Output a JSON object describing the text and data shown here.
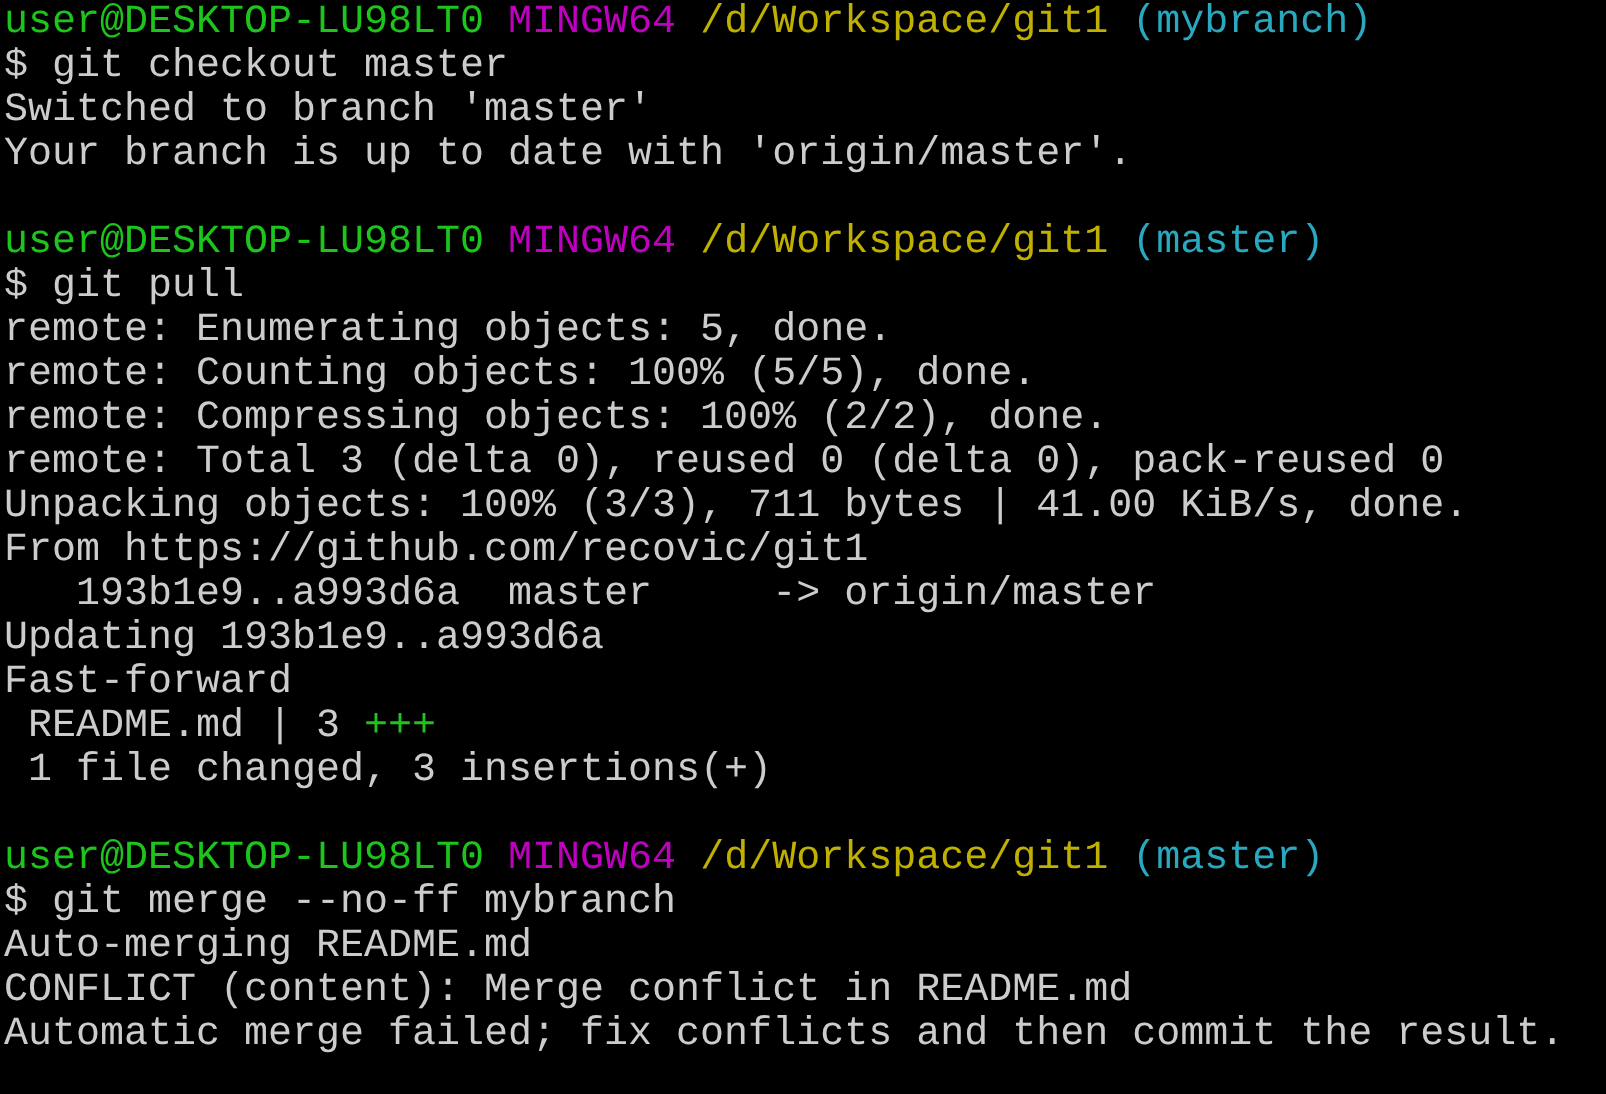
{
  "terminal": {
    "lines": [
      {
        "kind": "text",
        "segments": [
          {
            "text": "user@DESKTOP-LU98LT0",
            "color": "#1cc41c"
          },
          {
            "text": " MINGW64",
            "color": "#c000c0"
          },
          {
            "text": " /d/Workspace/git1",
            "color": "#c0b000"
          },
          {
            "text": " (mybranch)",
            "color": "#2aa8c0"
          }
        ]
      },
      {
        "kind": "text",
        "segments": [
          {
            "text": "$ git checkout master",
            "color": "#cccccc"
          }
        ]
      },
      {
        "kind": "text",
        "segments": [
          {
            "text": "Switched to branch 'master'",
            "color": "#cccccc"
          }
        ]
      },
      {
        "kind": "text",
        "segments": [
          {
            "text": "Your branch is up to date with 'origin/master'.",
            "color": "#cccccc"
          }
        ]
      },
      {
        "kind": "blank"
      },
      {
        "kind": "text",
        "segments": [
          {
            "text": "user@DESKTOP-LU98LT0",
            "color": "#1cc41c"
          },
          {
            "text": " MINGW64",
            "color": "#c000c0"
          },
          {
            "text": " /d/Workspace/git1",
            "color": "#c0b000"
          },
          {
            "text": " (master)",
            "color": "#2aa8c0"
          }
        ]
      },
      {
        "kind": "text",
        "segments": [
          {
            "text": "$ git pull",
            "color": "#cccccc"
          }
        ]
      },
      {
        "kind": "text",
        "segments": [
          {
            "text": "remote: Enumerating objects: 5, done.",
            "color": "#cccccc"
          }
        ]
      },
      {
        "kind": "text",
        "segments": [
          {
            "text": "remote: Counting objects: 100% (5/5), done.",
            "color": "#cccccc"
          }
        ]
      },
      {
        "kind": "text",
        "segments": [
          {
            "text": "remote: Compressing objects: 100% (2/2), done.",
            "color": "#cccccc"
          }
        ]
      },
      {
        "kind": "text",
        "segments": [
          {
            "text": "remote: Total 3 (delta 0), reused 0 (delta 0), pack-reused 0",
            "color": "#cccccc"
          }
        ]
      },
      {
        "kind": "text",
        "segments": [
          {
            "text": "Unpacking objects: 100% (3/3), 711 bytes | 41.00 KiB/s, done.",
            "color": "#cccccc"
          }
        ]
      },
      {
        "kind": "text",
        "segments": [
          {
            "text": "From https://github.com/recovic/git1",
            "color": "#cccccc"
          }
        ]
      },
      {
        "kind": "text",
        "segments": [
          {
            "text": "   193b1e9..a993d6a  master     -> origin/master",
            "color": "#cccccc"
          }
        ]
      },
      {
        "kind": "text",
        "segments": [
          {
            "text": "Updating 193b1e9..a993d6a",
            "color": "#cccccc"
          }
        ]
      },
      {
        "kind": "text",
        "segments": [
          {
            "text": "Fast-forward",
            "color": "#cccccc"
          }
        ]
      },
      {
        "kind": "text",
        "segments": [
          {
            "text": " README.md | 3 ",
            "color": "#cccccc"
          },
          {
            "text": "+++",
            "color": "#1cc41c"
          }
        ]
      },
      {
        "kind": "text",
        "segments": [
          {
            "text": " 1 file changed, 3 insertions(+)",
            "color": "#cccccc"
          }
        ]
      },
      {
        "kind": "blank"
      },
      {
        "kind": "text",
        "segments": [
          {
            "text": "user@DESKTOP-LU98LT0",
            "color": "#1cc41c"
          },
          {
            "text": " MINGW64",
            "color": "#c000c0"
          },
          {
            "text": " /d/Workspace/git1",
            "color": "#c0b000"
          },
          {
            "text": " (master)",
            "color": "#2aa8c0"
          }
        ]
      },
      {
        "kind": "text",
        "segments": [
          {
            "text": "$ git merge --no-ff mybranch",
            "color": "#cccccc"
          }
        ]
      },
      {
        "kind": "text",
        "segments": [
          {
            "text": "Auto-merging README.md",
            "color": "#cccccc"
          }
        ]
      },
      {
        "kind": "text",
        "segments": [
          {
            "text": "CONFLICT (content): Merge conflict in README.md",
            "color": "#cccccc"
          }
        ]
      },
      {
        "kind": "text",
        "segments": [
          {
            "text": "Automatic merge failed; fix conflicts and then commit the result.",
            "color": "#cccccc"
          }
        ]
      }
    ]
  }
}
